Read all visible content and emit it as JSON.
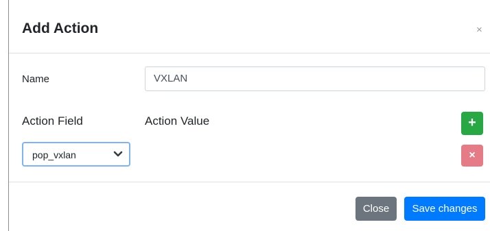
{
  "modal": {
    "title": "Add Action",
    "close_icon": "×"
  },
  "form": {
    "name_label": "Name",
    "name_value": "VXLAN",
    "action_field_header": "Action Field",
    "action_value_header": "Action Value",
    "add_icon": "+",
    "delete_icon": "×",
    "action_field_selected": "pop_vxlan"
  },
  "footer": {
    "close_label": "Close",
    "save_label": "Save changes"
  },
  "colors": {
    "add_button": "#28a745",
    "delete_button": "#e57b87",
    "close_button": "#6c757d",
    "save_button": "#007bff",
    "select_focus_border": "#7fb2f0"
  },
  "icons": {
    "close": "close-icon",
    "add": "plus-icon",
    "delete": "times-icon",
    "dropdown": "chevron-down-icon"
  }
}
